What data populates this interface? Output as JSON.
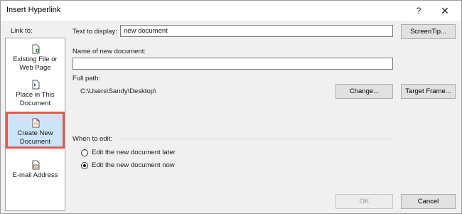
{
  "window": {
    "title": "Insert Hyperlink",
    "help_glyph": "?",
    "close_glyph": "✕"
  },
  "sidebar": {
    "header": "Link to:",
    "items": [
      {
        "line1": "Existing File or",
        "line2": "Web Page",
        "icon": "existing-file-icon"
      },
      {
        "line1": "Place in This",
        "line2": "Document",
        "icon": "place-in-document-icon"
      },
      {
        "line1": "Create New",
        "line2": "Document",
        "icon": "new-document-icon",
        "selected": true
      },
      {
        "line1": "E-mail Address",
        "line2": "",
        "icon": "email-address-icon"
      }
    ]
  },
  "form": {
    "text_to_display_label": "Text to display:",
    "text_to_display_value": "new document",
    "screentip_label": "ScreenTip...",
    "name_label": "Name of new document:",
    "name_value": "",
    "full_path_label": "Full path:",
    "full_path_value": "C:\\Users\\Sandy\\Desktop\\",
    "change_label": "Change...",
    "target_frame_label": "Target Frame...",
    "when_to_edit_label": "When to edit:",
    "options": [
      {
        "label": "Edit the new document later",
        "checked": false
      },
      {
        "label": "Edit the new document now",
        "checked": true
      }
    ]
  },
  "footer": {
    "ok_label": "OK",
    "cancel_label": "Cancel"
  },
  "colors": {
    "selection_fill": "#cce4f7",
    "highlight_border": "#e05a4f"
  }
}
